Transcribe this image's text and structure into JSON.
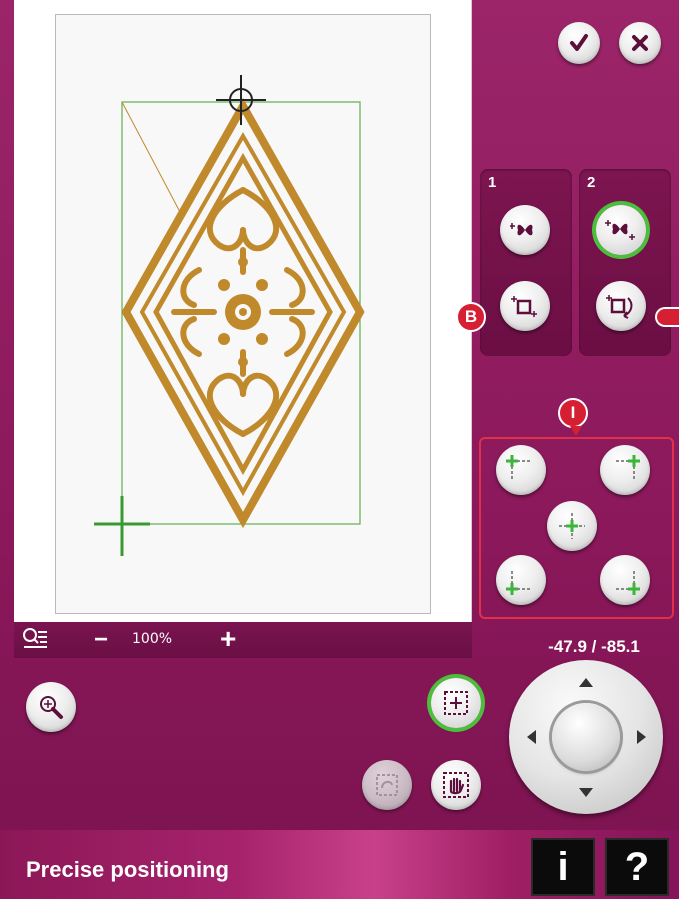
{
  "zoom": {
    "percent": "100%",
    "minus": "−",
    "plus": "+"
  },
  "panels": {
    "one": "1",
    "two": "2"
  },
  "callouts": {
    "b": "B",
    "i": "I"
  },
  "coordinates": "-47.9 / -85.1",
  "status": {
    "title": "Precise positioning"
  },
  "help": {
    "info": "i",
    "question": "?"
  },
  "colors": {
    "accent": "#8e1a5c",
    "selected_ring": "#4bbf3c",
    "callout": "#d71f34",
    "embroidery": "#c08a2c"
  },
  "icons": [
    "confirm-icon",
    "cancel-icon",
    "zoom-options-icon",
    "zoom-in-icon",
    "butterfly-move-icon",
    "corner-position-icon",
    "rotate-icon",
    "pan-icon",
    "info-icon",
    "help-icon"
  ]
}
